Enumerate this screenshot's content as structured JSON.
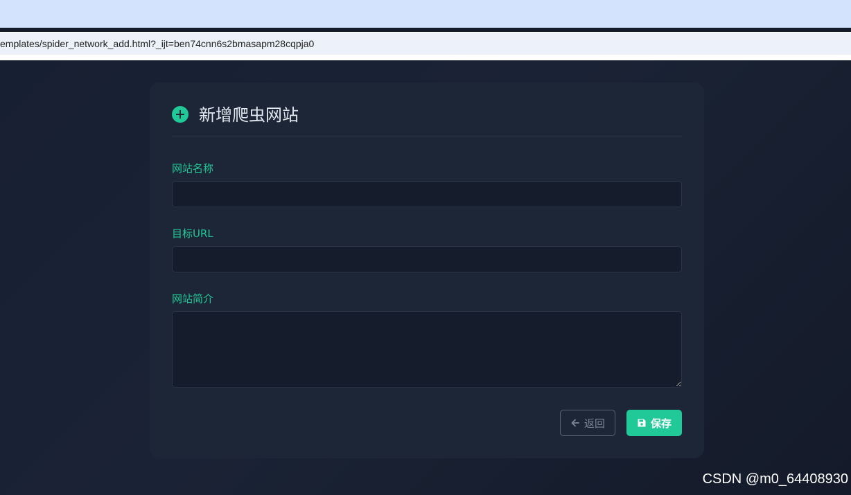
{
  "browser": {
    "address_text": "emplates/spider_network_add.html?_ijt=ben74cnn6s2bmasapm28cqpja0"
  },
  "form": {
    "title": "新增爬虫网站",
    "fields": {
      "name_label": "网站名称",
      "name_value": "",
      "url_label": "目标URL",
      "url_value": "",
      "desc_label": "网站简介",
      "desc_value": ""
    },
    "back_label": "返回",
    "save_label": "保存"
  },
  "watermark": "CSDN @m0_64408930",
  "icons": {
    "title": "plus-circle-icon",
    "back": "arrow-left-icon",
    "save": "floppy-disk-icon"
  },
  "colors": {
    "accent": "#20c997",
    "card": "#1d2637",
    "page": "#141b2b"
  }
}
